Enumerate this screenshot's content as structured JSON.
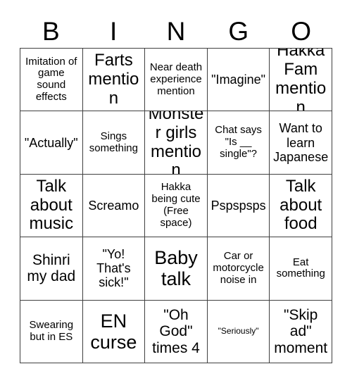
{
  "card": {
    "title": "BINGO",
    "header_letters": [
      "B",
      "I",
      "N",
      "G",
      "O"
    ],
    "free_space_index": 12,
    "colors": {
      "background": "#ffffff",
      "text": "#000000",
      "border": "#404040"
    },
    "grid": {
      "rows": 5,
      "columns": 5
    },
    "cells": [
      {
        "text": "Imitation of game sound effects",
        "size": "sm"
      },
      {
        "text": "Farts mention",
        "size": "xl"
      },
      {
        "text": "Near death experience mention",
        "size": "sm"
      },
      {
        "text": "\"Imagine\"",
        "size": "md"
      },
      {
        "text": "Hakka Fam mention",
        "size": "xl"
      },
      {
        "text": "\"Actually\"",
        "size": "md"
      },
      {
        "text": "Sings something",
        "size": "sm"
      },
      {
        "text": "Monster girls mention",
        "size": "xl"
      },
      {
        "text": "Chat says \"Is __ single\"?",
        "size": "sm"
      },
      {
        "text": "Want to learn Japanese",
        "size": "md"
      },
      {
        "text": "Talk about music",
        "size": "xl"
      },
      {
        "text": "Screamo",
        "size": "md"
      },
      {
        "text": "Hakka being cute (Free space)",
        "size": "sm"
      },
      {
        "text": "Pspspsps",
        "size": "md"
      },
      {
        "text": "Talk about food",
        "size": "xl"
      },
      {
        "text": "Shinri my dad",
        "size": "lg"
      },
      {
        "text": "\"Yo! That's sick!\"",
        "size": "md"
      },
      {
        "text": "Baby talk",
        "size": "xxl"
      },
      {
        "text": "Car or motorcycle noise in",
        "size": "sm"
      },
      {
        "text": "Eat something",
        "size": "sm"
      },
      {
        "text": "Swearing but in ES",
        "size": "sm"
      },
      {
        "text": "EN curse",
        "size": "xxl"
      },
      {
        "text": "\"Oh God\" times 4",
        "size": "lg"
      },
      {
        "text": "\"Seriously\"",
        "size": "xxs"
      },
      {
        "text": "\"Skip ad\" moment",
        "size": "lg"
      }
    ]
  }
}
